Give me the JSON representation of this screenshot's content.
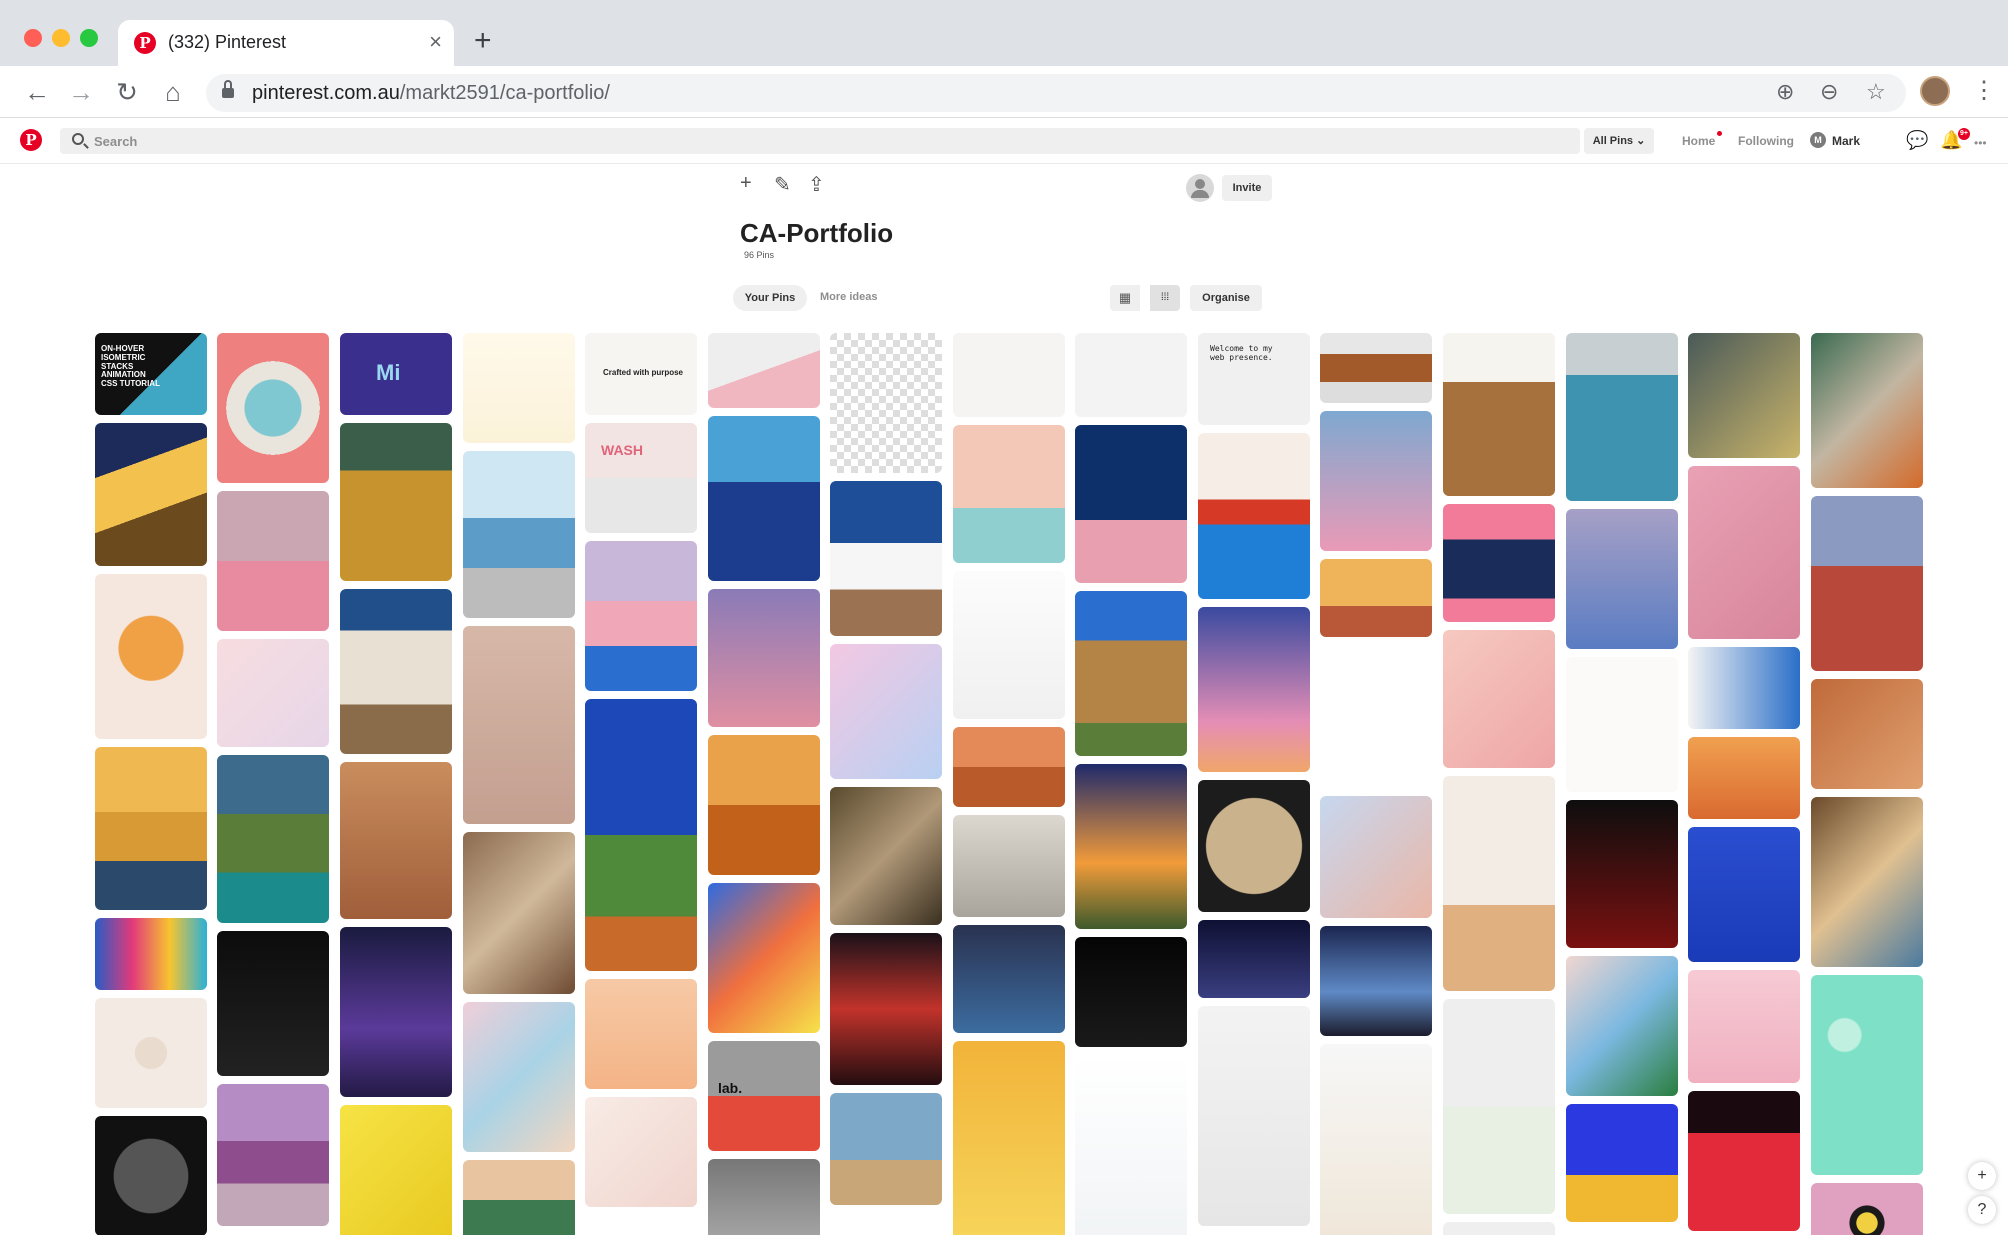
{
  "browser": {
    "tab_title": "(332) Pinterest",
    "tab_favicon": "P",
    "tab_close": "×",
    "new_tab": "+",
    "url_host": "pinterest.com.au",
    "url_path": "/markt2591/ca-portfolio/",
    "nav": {
      "back": "←",
      "forward": "→",
      "reload": "↻",
      "home": "⌂"
    },
    "omni_icons": {
      "add": "⊕",
      "zoom": "⊖",
      "star": "☆"
    },
    "menu": "⋮"
  },
  "pinterest": {
    "logo": "P",
    "search_placeholder": "Search",
    "all_pins": "All Pins ⌄",
    "home": "Home",
    "following": "Following",
    "user_initial": "M",
    "user_name": "Mark",
    "chat_icon": "💬",
    "bell_icon": "🔔",
    "more_icon": "•••",
    "notif_count": "9+"
  },
  "board": {
    "title": "CA-Portfolio",
    "pin_count": "96 Pins",
    "tools": {
      "add": "+",
      "edit": "✎",
      "share": "⇪"
    },
    "invite": "Invite",
    "tabs": {
      "your_pins": "Your Pins",
      "more_ideas": "More ideas"
    },
    "view_small": "▦",
    "view_large": "⁞⁞⁞",
    "organise": "Organise"
  },
  "pin_texts": {
    "isometric": "ON-HOVER ISOMETRIC STACKS ANIMATION CSS TUTORIAL",
    "mi": "Mi",
    "wash": "WASH",
    "crafted": "Crafted with purpose",
    "welcome": "Welcome to my web presence.",
    "lab": "lab."
  },
  "float": {
    "plus": "+",
    "help": "?"
  },
  "colors": {
    "brand": "#e60023"
  }
}
